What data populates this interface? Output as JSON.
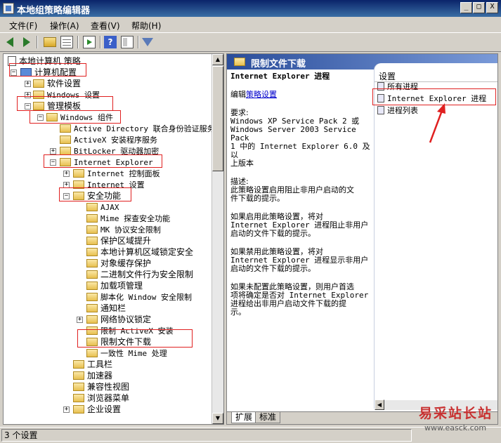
{
  "window": {
    "title": "本地组策略编辑器",
    "buttons": [
      "_",
      "□",
      "X"
    ]
  },
  "menu": [
    {
      "label": "文件(F)"
    },
    {
      "label": "操作(A)"
    },
    {
      "label": "查看(V)"
    },
    {
      "label": "帮助(H)"
    }
  ],
  "toolbar_icons": [
    "back-arrow-icon",
    "forward-arrow-icon",
    "up-folder-icon",
    "show-hide-tree-icon",
    "export-list-icon",
    "help-icon",
    "properties-icon",
    "filter-icon"
  ],
  "tree": [
    {
      "label": "本地计算机 策略",
      "icon": "doc"
    },
    {
      "label": "计算机配置",
      "icon": "pc"
    },
    {
      "label": "软件设置",
      "icon": "folder"
    },
    {
      "label": "Windows 设置",
      "icon": "folder"
    },
    {
      "label": "管理模板",
      "icon": "folder"
    },
    {
      "label": "Windows 组件",
      "icon": "folder"
    },
    {
      "label": "Active Directory 联合身份验证服务",
      "icon": "folder"
    },
    {
      "label": "ActiveX 安装程序服务",
      "icon": "folder"
    },
    {
      "label": "BitLocker 驱动器加密",
      "icon": "folder"
    },
    {
      "label": "Internet Explorer",
      "icon": "folder"
    },
    {
      "label": "Internet 控制面板",
      "icon": "folder"
    },
    {
      "label": "Internet 设置",
      "icon": "folder"
    },
    {
      "label": "安全功能",
      "icon": "folder"
    },
    {
      "label": "AJAX",
      "icon": "folder"
    },
    {
      "label": "Mime 探查安全功能",
      "icon": "folder"
    },
    {
      "label": "MK 协议安全限制",
      "icon": "folder"
    },
    {
      "label": "保护区域提升",
      "icon": "folder"
    },
    {
      "label": "本地计算机区域锁定安全",
      "icon": "folder"
    },
    {
      "label": "对象缓存保护",
      "icon": "folder"
    },
    {
      "label": "二进制文件行为安全限制",
      "icon": "folder"
    },
    {
      "label": "加载项管理",
      "icon": "folder"
    },
    {
      "label": "脚本化 Window 安全限制",
      "icon": "folder"
    },
    {
      "label": "通知栏",
      "icon": "folder"
    },
    {
      "label": "网络协议锁定",
      "icon": "folder"
    },
    {
      "label": "限制 ActiveX 安装",
      "icon": "folder"
    },
    {
      "label": "限制文件下载",
      "icon": "folder"
    },
    {
      "label": "一致性 Mime 处理",
      "icon": "folder"
    },
    {
      "label": "工具栏",
      "icon": "folder"
    },
    {
      "label": "加速器",
      "icon": "folder"
    },
    {
      "label": "兼容性视图",
      "icon": "folder"
    },
    {
      "label": "浏览器菜单",
      "icon": "folder"
    },
    {
      "label": "企业设置",
      "icon": "folder"
    }
  ],
  "right": {
    "header": "限制文件下载",
    "desc": {
      "title": "Internet Explorer 进程",
      "edit_prefix": "编辑",
      "edit_link": "策略设置",
      "req_label": "要求:",
      "req_lines": [
        "Windows XP Service Pack 2 或",
        "Windows Server 2003 Service Pack",
        "1 中的 Internet Explorer 6.0 及以",
        "上版本"
      ],
      "desc_label": "描述:",
      "desc_lines": [
        "此策略设置启用阻止非用户启动的文",
        "件下载的提示。"
      ],
      "p1_lines": [
        "如果启用此策略设置，将对",
        "Internet Explorer 进程阻止非用户",
        "启动的文件下载的提示。"
      ],
      "p2_lines": [
        "如果禁用此策略设置，将对",
        "Internet Explorer 进程显示非用户",
        "启动的文件下载的提示。"
      ],
      "p3_lines": [
        "如果未配置此策略设置，则用户首选",
        "项将确定是否对 Internet Explorer",
        "进程给出非用户启动文件下载的提",
        "示。"
      ]
    },
    "column_header": "设置",
    "settings": [
      {
        "label": "所有进程"
      },
      {
        "label": "Internet Explorer 进程"
      },
      {
        "label": "进程列表"
      }
    ],
    "tabs": [
      {
        "label": "扩展"
      },
      {
        "label": "标准"
      }
    ]
  },
  "status": "3 个设置",
  "watermark": {
    "cn": "易采站长站",
    "url": "www.easck.com"
  },
  "colors": {
    "title_bar": "#0a246a",
    "highlight_box": "#e02020"
  }
}
